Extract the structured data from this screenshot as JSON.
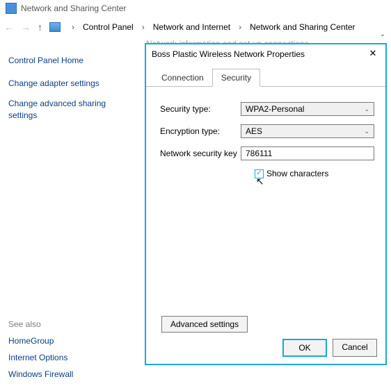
{
  "titlebar": {
    "title": "Network and Sharing Center"
  },
  "nav": {
    "crumbs": [
      "Control Panel",
      "Network and Internet",
      "Network and Sharing Center"
    ]
  },
  "cutoff_text": "Network information and set up connections",
  "leftpane": {
    "home": "Control Panel Home",
    "links": [
      "Change adapter settings",
      "Change advanced sharing settings"
    ]
  },
  "seealso": {
    "header": "See also",
    "links": [
      "HomeGroup",
      "Internet Options",
      "Windows Firewall"
    ]
  },
  "dialog": {
    "title": "Boss Plastic Wireless Network Properties",
    "tabs": [
      "Connection",
      "Security"
    ],
    "active_tab": "Security",
    "fields": {
      "security_type": {
        "label": "Security type:",
        "value": "WPA2-Personal"
      },
      "encryption_type": {
        "label": "Encryption type:",
        "value": "AES"
      },
      "network_key": {
        "label": "Network security key",
        "value": "786111"
      }
    },
    "show_characters": {
      "label": "Show characters",
      "checked": true
    },
    "advanced": "Advanced settings",
    "buttons": {
      "ok": "OK",
      "cancel": "Cancel"
    }
  }
}
